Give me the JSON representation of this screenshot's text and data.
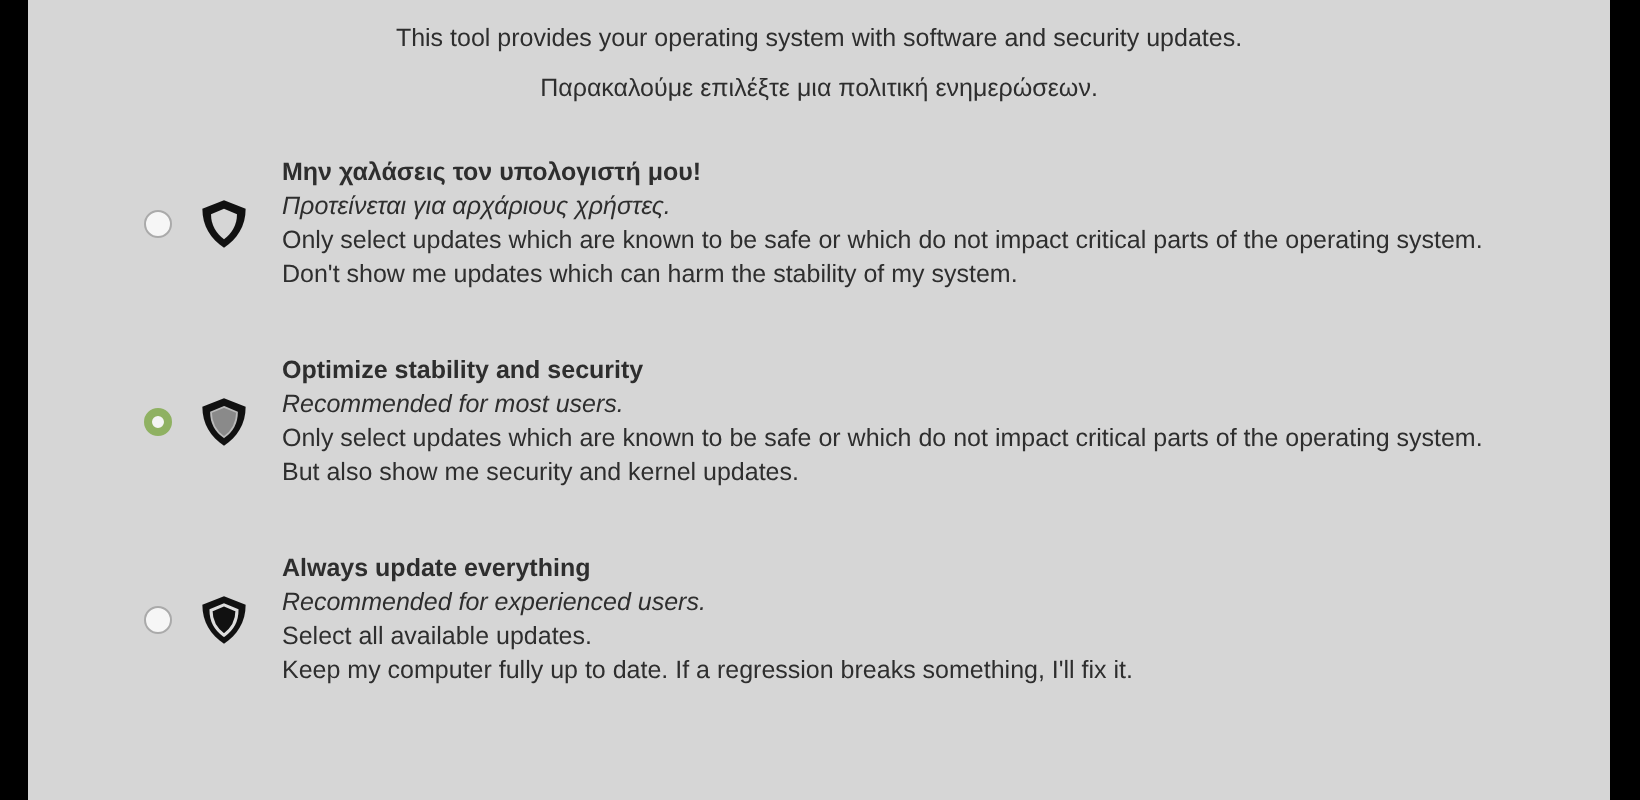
{
  "intro": [
    "This tool provides your operating system with software and security updates.",
    "Παρακαλούμε επιλέξτε μια πολιτική ενημερώσεων."
  ],
  "options": [
    {
      "kind": "outline",
      "selected": false,
      "title": "Μην χαλάσεις τον υπολογιστή μου!",
      "subtitle": "Προτείνεται για αρχάριους χρήστες.",
      "lines": [
        "Only select updates which are known to be safe or which do not impact critical parts of the operating system.",
        "Don't show me updates which can harm the stability of my system."
      ]
    },
    {
      "kind": "half",
      "selected": true,
      "title": "Optimize stability and security",
      "subtitle": "Recommended for most users.",
      "lines": [
        "Only select updates which are known to be safe or which do not impact critical parts of the operating system.",
        "But also show me security and kernel updates."
      ]
    },
    {
      "kind": "solid",
      "selected": false,
      "title": "Always update everything",
      "subtitle": "Recommended for experienced users.",
      "lines": [
        "Select all available updates.",
        "Keep my computer fully up to date. If a regression breaks something, I'll fix it."
      ]
    }
  ]
}
